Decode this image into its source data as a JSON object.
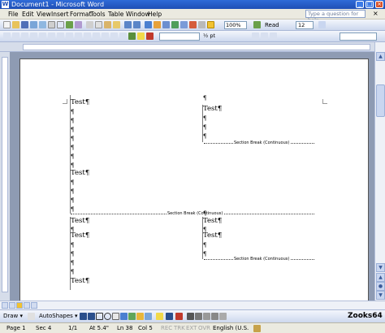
{
  "window": {
    "title": "Document1 - Microsoft Word",
    "app_icon": "W"
  },
  "menu": {
    "items": [
      "File",
      "Edit",
      "View",
      "Insert",
      "Format",
      "Tools",
      "Table",
      "Window",
      "Help"
    ],
    "help_placeholder": "Type a question for help",
    "close_glyph": "×"
  },
  "toolbar": {
    "zoom": "100%",
    "read_label": "Read",
    "font_size": "12",
    "spacing": "½ pt"
  },
  "document": {
    "text_word": "Test",
    "pilcrow": "¶",
    "section_break_label": "Section Break (Continuous)"
  },
  "drawing": {
    "draw_label": "Draw ▾",
    "autoshapes_label": "AutoShapes ▾"
  },
  "watermark": "Zooks64",
  "status": {
    "page": "Page  1",
    "sec": "Sec  4",
    "pages": "1/1",
    "at": "At  5.4\"",
    "ln": "Ln  38",
    "col": "Col  5",
    "rec": "REC",
    "trk": "TRK",
    "ext": "EXT",
    "ovr": "OVR",
    "lang": "English (U.S."
  }
}
